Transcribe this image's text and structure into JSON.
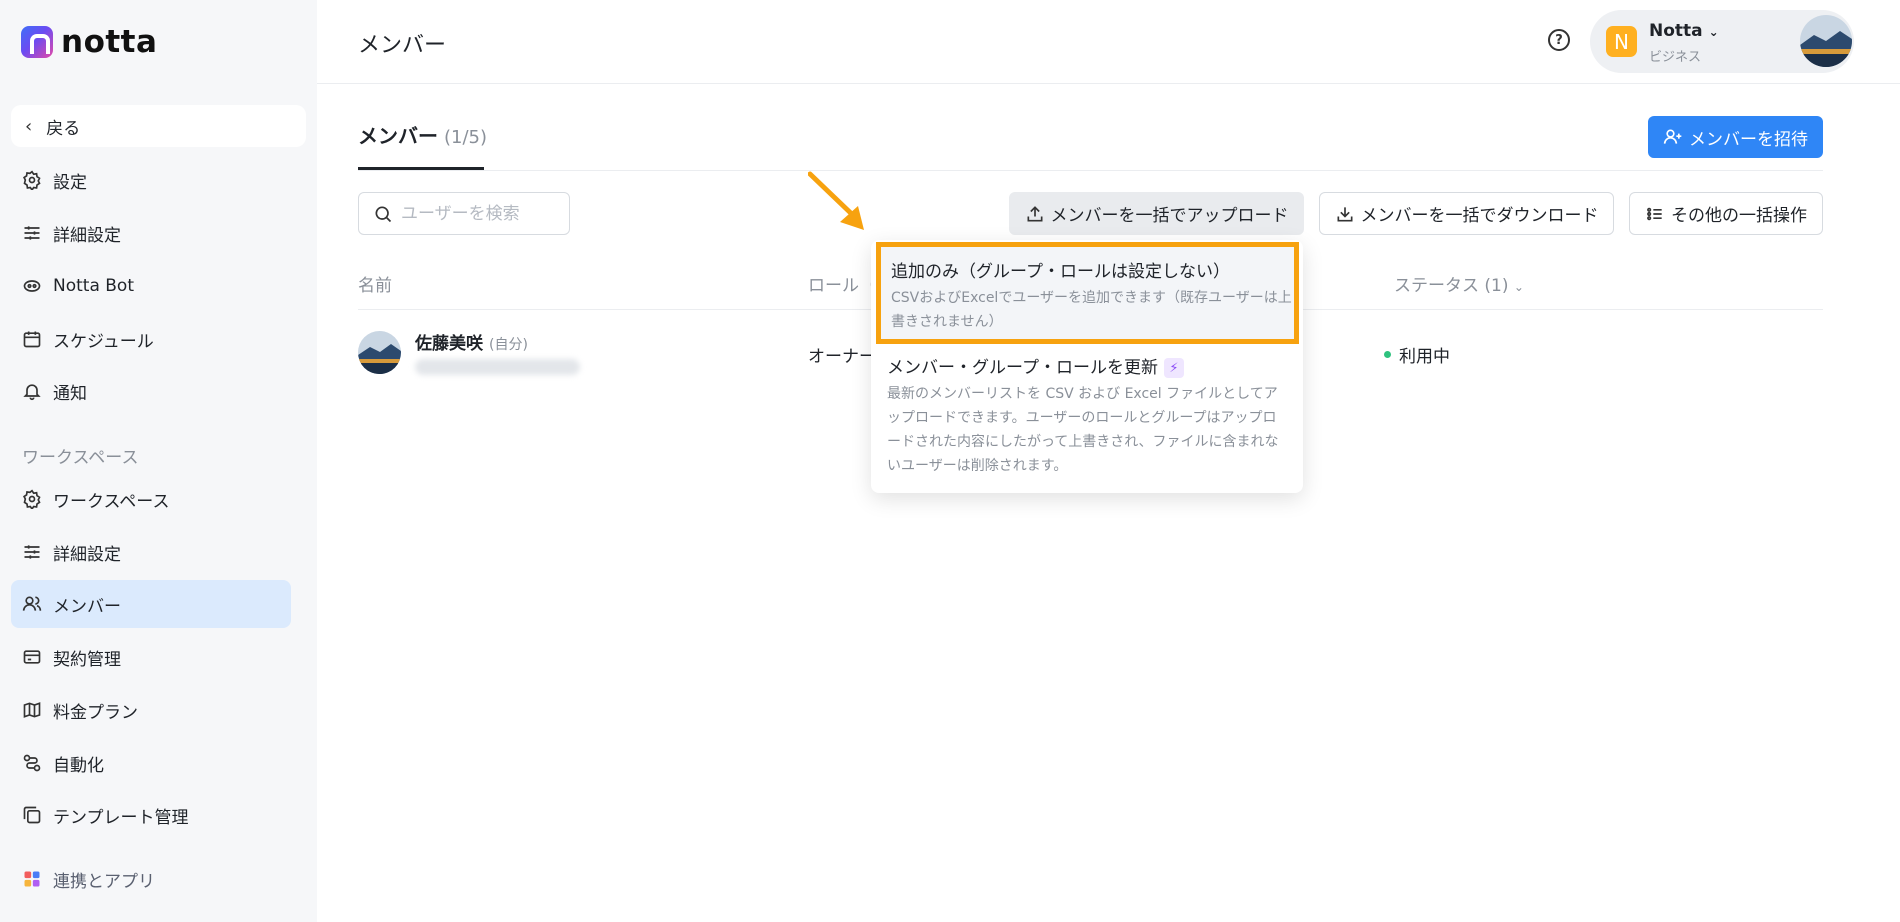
{
  "brand": {
    "name": "notta"
  },
  "sidebar": {
    "back_label": "戻る",
    "items_top": [
      {
        "label": "設定",
        "icon": "gear-icon"
      },
      {
        "label": "詳細設定",
        "icon": "sliders-icon"
      },
      {
        "label": "Notta Bot",
        "icon": "bot-icon"
      },
      {
        "label": "スケジュール",
        "icon": "calendar-icon"
      },
      {
        "label": "通知",
        "icon": "bell-icon"
      }
    ],
    "section_label": "ワークスペース",
    "items_ws": [
      {
        "label": "ワークスペース",
        "icon": "gear-icon"
      },
      {
        "label": "詳細設定",
        "icon": "sliders-icon"
      },
      {
        "label": "メンバー",
        "icon": "users-icon",
        "active": true
      },
      {
        "label": "契約管理",
        "icon": "credit-card-icon"
      },
      {
        "label": "料金プラン",
        "icon": "map-icon"
      },
      {
        "label": "自動化",
        "icon": "automation-icon"
      },
      {
        "label": "テンプレート管理",
        "icon": "template-icon"
      }
    ],
    "integrations_label": "連携とアプリ"
  },
  "header": {
    "title": "メンバー",
    "account": {
      "badge": "N",
      "name": "Notta",
      "plan": "ビジネス"
    }
  },
  "main": {
    "tab_label": "メンバー",
    "tab_count": "(1/5)",
    "invite_label": "メンバーを招待",
    "search_placeholder": "ユーザーを検索",
    "bulk_upload_label": "メンバーを一括でアップロード",
    "bulk_download_label": "メンバーを一括でダウンロード",
    "other_ops_label": "その他の一括操作",
    "columns": {
      "name": "名前",
      "role": "ロール（",
      "status": "ステータス (1)"
    },
    "rows": [
      {
        "name": "佐藤美咲",
        "self_tag": "(自分)",
        "role": "オーナー",
        "status": "利用中"
      }
    ]
  },
  "dropdown": {
    "option1": {
      "title": "追加のみ（グループ・ロールは設定しない）",
      "desc": "CSVおよびExcelでユーザーを追加できます（既存ユーザーは上書きされません）"
    },
    "option2": {
      "title": "メンバー・グループ・ロールを更新",
      "desc": "最新のメンバーリストを CSV および Excel ファイルとしてアップロードできます。ユーザーのロールとグループはアップロードされた内容にしたがって上書きされ、ファイルに含まれないユーザーは削除されます。"
    }
  },
  "colors": {
    "accent": "#2f86f6",
    "highlight": "#f7a20f",
    "active_nav": "#dbeafd",
    "status_active": "#2ec27e"
  }
}
